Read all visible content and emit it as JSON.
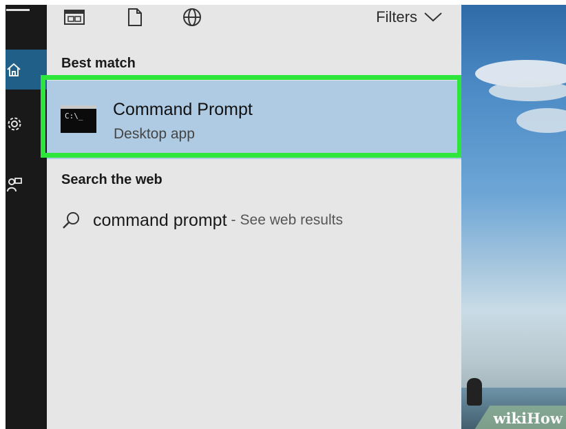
{
  "toolbar": {
    "filters_label": "Filters"
  },
  "best_match": {
    "heading": "Best match",
    "app_name": "Command Prompt",
    "app_type": "Desktop app",
    "app_icon_text": "C:\\_"
  },
  "search_web": {
    "heading": "Search the web",
    "query": "command prompt",
    "separator": "-",
    "see_results": "See web results"
  },
  "watermark": {
    "part1": "wiki",
    "part2": "How"
  },
  "colors": {
    "highlight": "#2ee63b",
    "selected_bg": "#aecbe3",
    "rail_active": "#1f5f88"
  }
}
